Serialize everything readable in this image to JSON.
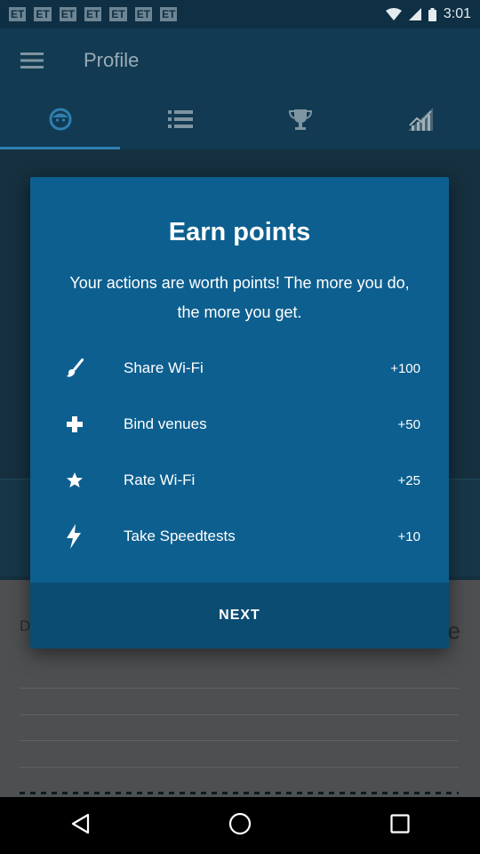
{
  "status_bar": {
    "left_icons": [
      "ET",
      "ET",
      "ET",
      "ET",
      "ET",
      "ET",
      "ET"
    ],
    "time": "3:01"
  },
  "app_bar": {
    "title": "Profile",
    "menu_icon": "hamburger-menu-icon"
  },
  "tabs": [
    {
      "icon": "face-icon",
      "active": true
    },
    {
      "icon": "list-icon",
      "active": false
    },
    {
      "icon": "trophy-icon",
      "active": false
    },
    {
      "icon": "signal-chart-icon",
      "active": false
    }
  ],
  "background": {
    "left_letter": "D",
    "right_text": "g ye"
  },
  "dialog": {
    "title": "Earn points",
    "description": "Your actions are worth points! The more you do, the more you get.",
    "actions": [
      {
        "label": "Share Wi-Fi",
        "points": "+100",
        "icon": "brush-icon"
      },
      {
        "label": "Bind venues",
        "points": "+50",
        "icon": "plus-icon"
      },
      {
        "label": "Rate Wi-Fi",
        "points": "+25",
        "icon": "star-icon"
      },
      {
        "label": "Take Speedtests",
        "points": "+10",
        "icon": "lightning-icon"
      }
    ],
    "next_label": "NEXT"
  },
  "colors": {
    "dialog_bg": "#0d5f8f",
    "dialog_footer_bg": "#0b4c73",
    "app_bar_bg": "#123a52"
  }
}
